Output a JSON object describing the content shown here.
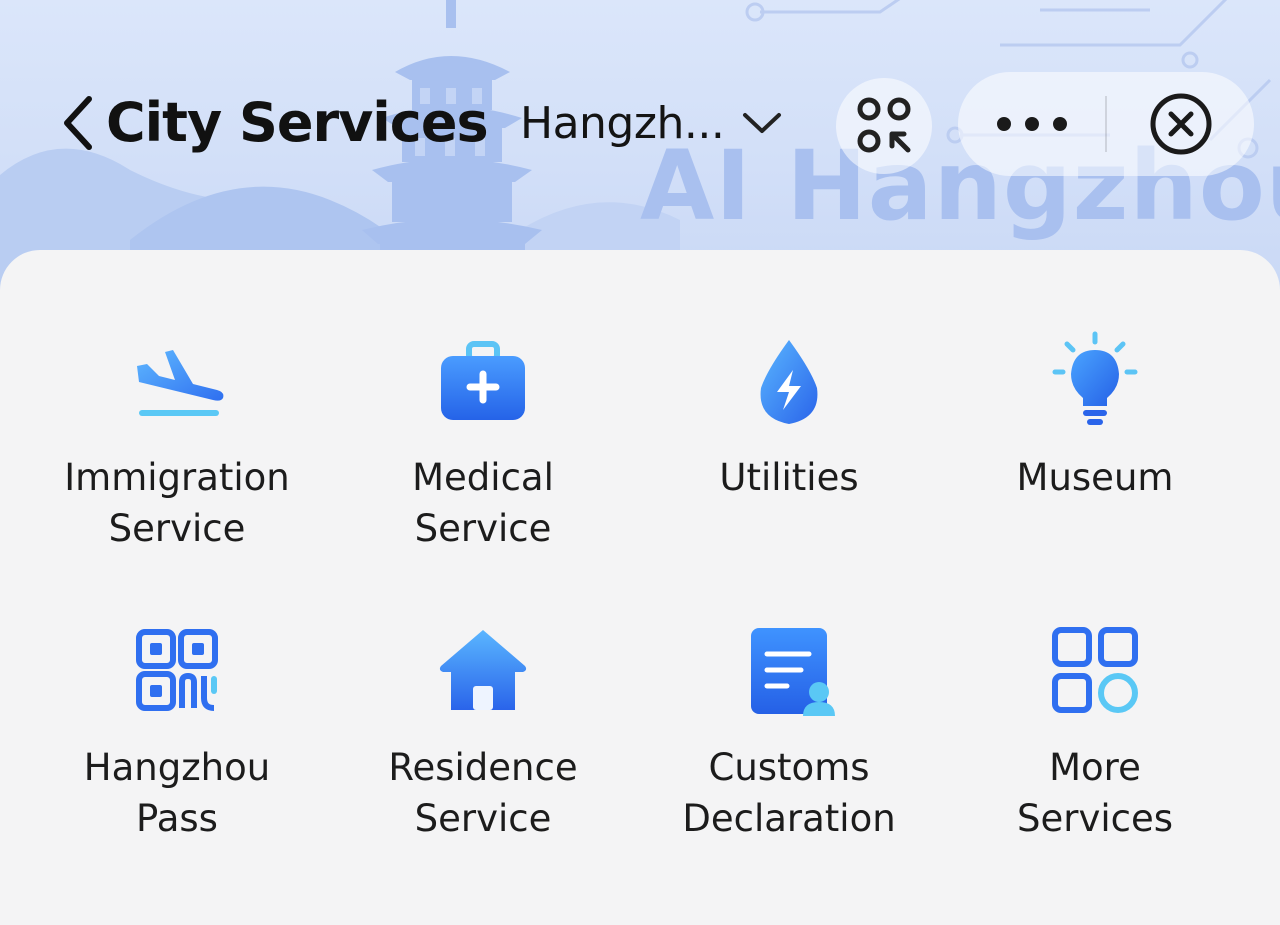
{
  "header": {
    "title": "City Services",
    "city_selector": "Hangzh...",
    "watermark": "AI Hangzhou"
  },
  "icons": {
    "back": "chevron-left-icon",
    "city_dropdown": "chevron-down-icon",
    "scan": "scan-icon",
    "more": "more-dots-icon",
    "close": "close-circle-icon"
  },
  "services": [
    {
      "line1": "Immigration",
      "line2": "Service",
      "icon": "airplane-landing-icon"
    },
    {
      "line1": "Medical",
      "line2": "Service",
      "icon": "medical-kit-icon"
    },
    {
      "line1": "Utilities",
      "line2": "",
      "icon": "water-drop-bolt-icon"
    },
    {
      "line1": "Museum",
      "line2": "",
      "icon": "lightbulb-icon"
    },
    {
      "line1": "Hangzhou",
      "line2": "Pass",
      "icon": "qr-code-icon"
    },
    {
      "line1": "Residence",
      "line2": "Service",
      "icon": "house-icon"
    },
    {
      "line1": "Customs",
      "line2": "Declaration",
      "icon": "declaration-document-icon"
    },
    {
      "line1": "More",
      "line2": "Services",
      "icon": "grid-apps-icon"
    }
  ],
  "colors": {
    "accent_blue": "#2f6ff0",
    "accent_light": "#5ab6ff",
    "panel_bg": "#f4f4f5",
    "hero_bg": "#d6e2f9"
  }
}
